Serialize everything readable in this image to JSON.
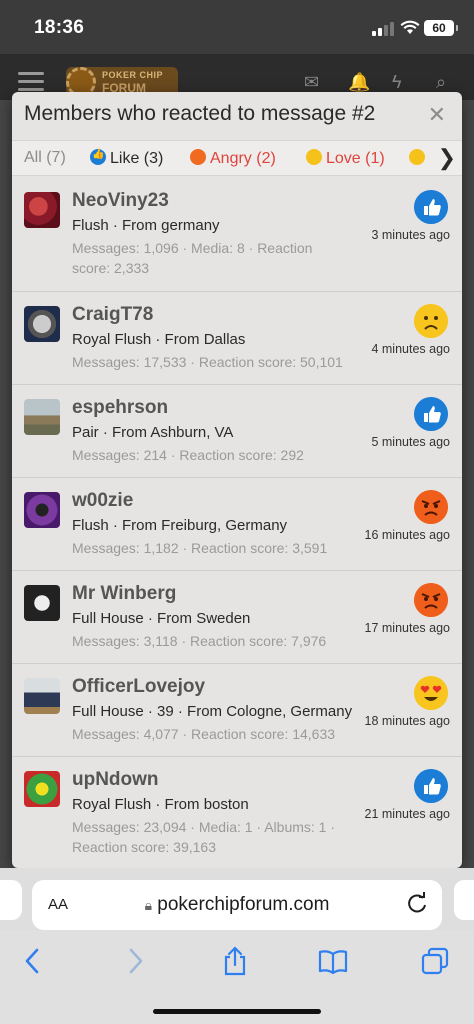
{
  "status_bar": {
    "time": "18:36",
    "battery": "60"
  },
  "site": {
    "logo_line1": "POKER CHIP",
    "logo_line2": "FORUM",
    "icons": [
      "menu-icon",
      "mail-icon",
      "bell-icon",
      "bolt-icon",
      "search-icon"
    ]
  },
  "modal": {
    "title": "Members who reacted to message #2",
    "close": "✕",
    "tabs": [
      {
        "label": "All (7)"
      },
      {
        "label": "Like (3)",
        "emoji": "like"
      },
      {
        "label": "Angry (2)",
        "emoji": "angry"
      },
      {
        "label": "Love (1)",
        "emoji": "love"
      },
      {
        "label": "",
        "emoji": "sad"
      }
    ],
    "tabs_next": "❯",
    "members": [
      {
        "name": "NeoViny23",
        "title": "Flush · From germany",
        "stats": "Messages: 1,096 · Media: 8 · Reaction score: 2,333",
        "reaction": "like",
        "time": "3 minutes ago"
      },
      {
        "name": "CraigT78",
        "title": "Royal Flush · From Dallas",
        "stats": "Messages: 17,533 · Reaction score: 50,101",
        "reaction": "sad",
        "time": "4 minutes ago"
      },
      {
        "name": "espehrson",
        "title": "Pair · From Ashburn, VA",
        "stats": "Messages: 214 · Reaction score: 292",
        "reaction": "like",
        "time": "5 minutes ago"
      },
      {
        "name": "w00zie",
        "title": "Flush · From Freiburg, Germany",
        "stats": "Messages: 1,182 · Reaction score: 3,591",
        "reaction": "angry",
        "time": "16 minutes ago"
      },
      {
        "name": "Mr Winberg",
        "title": "Full House · From Sweden",
        "stats": "Messages: 3,118 · Reaction score: 7,976",
        "reaction": "angry",
        "time": "17 minutes ago"
      },
      {
        "name": "OfficerLovejoy",
        "title": "Full House · 39 · From Cologne, Germany",
        "stats": "Messages: 4,077 · Reaction score: 14,633",
        "reaction": "love",
        "time": "18 minutes ago"
      },
      {
        "name": "upNdown",
        "title": "Royal Flush · From boston",
        "stats": "Messages: 23,094 · Media: 1 · Albums: 1 · Reaction score: 39,163",
        "reaction": "like",
        "time": "21 minutes ago"
      }
    ]
  },
  "browser": {
    "text_size": "AA",
    "url": "pokerchipforum.com"
  }
}
